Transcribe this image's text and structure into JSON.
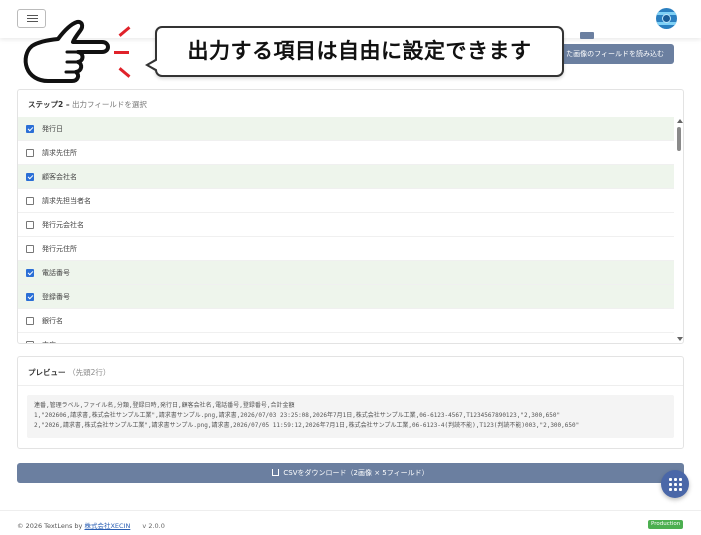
{
  "header": {
    "menu_icon": "hamburger-menu-icon",
    "logo_icon": "globe-logo-icon",
    "load_button_label": "た画像のフィールドを読み込む"
  },
  "banner": {
    "hand_icon": "pointing-hand-icon",
    "callout_text": "出力する項目は自由に設定できます",
    "accent_color": "#e0222a"
  },
  "step2": {
    "title_bold": "ステップ2 –",
    "title_sub": "出力フィールドを選択",
    "fields": [
      {
        "label": "発行日",
        "checked": true
      },
      {
        "label": "請求先住所",
        "checked": false
      },
      {
        "label": "顧客会社名",
        "checked": true
      },
      {
        "label": "請求先担当者名",
        "checked": false
      },
      {
        "label": "発行元会社名",
        "checked": false
      },
      {
        "label": "発行元住所",
        "checked": false
      },
      {
        "label": "電話番号",
        "checked": true
      },
      {
        "label": "登録番号",
        "checked": true
      },
      {
        "label": "銀行名",
        "checked": false
      },
      {
        "label": "支店",
        "checked": false
      }
    ]
  },
  "preview": {
    "title": "プレビュー",
    "subtitle": "（先頭2行）",
    "lines": [
      "連番,管理ラベル,ファイル名,分類,登録日時,発行日,顧客会社名,電話番号,登録番号,合計金額",
      "1,\"202606,請求書,株式会社サンプル工業\",請求書サンプル.png,請求書,2026/07/03 23:25:08,2026年7月1日,株式会社サンプル工業,06-6123-4567,T1234567890123,\"2,300,650\"",
      "2,\"2026,請求書,株式会社サンプル工業\",請求書サンプル.png,請求書,2026/07/05 11:59:12,2026年7月1日,株式会社サンプル工業,06-6123-4(判読不能),T123(判読不能)003,\"2,300,650\""
    ]
  },
  "download": {
    "label": "CSVをダウンロード（2画像 × 5フィールド）",
    "icon": "download-icon"
  },
  "fab": {
    "icon": "apps-grid-icon"
  },
  "footer": {
    "copyright": "© 2026 TextLens by",
    "company_link": "株式会社XECIN",
    "version": "v 2.0.0",
    "env_badge": "Production",
    "badge_color": "#4caf50"
  }
}
